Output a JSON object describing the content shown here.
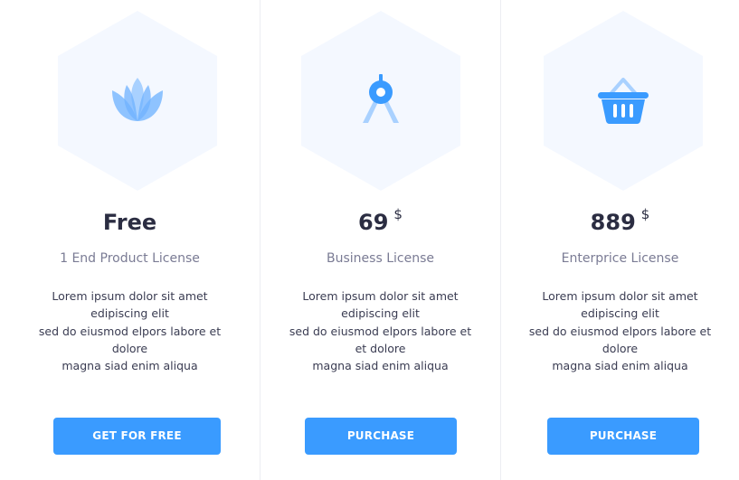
{
  "plans": [
    {
      "icon": "lotus-icon",
      "price": "Free",
      "currency": "",
      "license": "1 End Product License",
      "description": [
        "Lorem ipsum dolor sit amet",
        "edipiscing elit",
        "sed do eiusmod elpors labore et",
        "dolore",
        "magna siad enim aliqua"
      ],
      "button_label": "GET FOR FREE"
    },
    {
      "icon": "compass-icon",
      "price": "69",
      "currency": "$",
      "license": "Business License",
      "description": [
        "Lorem ipsum dolor sit amet",
        "edipiscing elit",
        "sed do eiusmod elpors labore et",
        "et dolore",
        "magna siad enim aliqua"
      ],
      "button_label": "PURCHASE"
    },
    {
      "icon": "basket-icon",
      "price": "889",
      "currency": "$",
      "license": "Enterprice License",
      "description": [
        "Lorem ipsum dolor sit amet",
        "edipiscing elit",
        "sed do eiusmod elpors labore et",
        "dolore",
        "magna siad enim aliqua"
      ],
      "button_label": "PURCHASE"
    }
  ],
  "colors": {
    "accent": "#3a9bff",
    "hexagon_fill": "#f4f8ff",
    "title": "#2b2d42",
    "muted": "#7a7b94"
  }
}
